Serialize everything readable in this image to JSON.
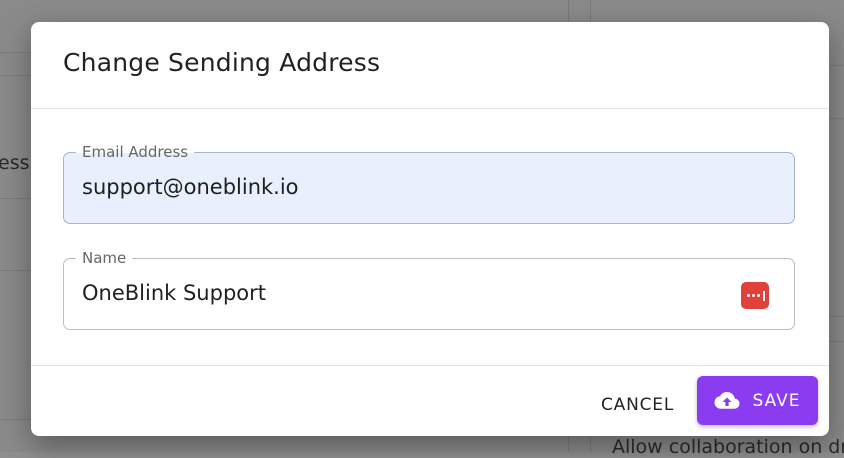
{
  "background": {
    "partial_text_left": "ess n",
    "partial_text_right_bottom": "Allow collaboration on dr"
  },
  "dialog": {
    "title": "Change Sending Address",
    "fields": [
      {
        "label": "Email Address",
        "value": "support@oneblink.io",
        "filled": true
      },
      {
        "label": "Name",
        "value": "OneBlink Support",
        "icon": "password-manager-icon"
      }
    ],
    "actions": {
      "cancel_label": "CANCEL",
      "save_label": "SAVE",
      "save_icon": "cloud-upload-icon"
    }
  },
  "colors": {
    "accent": "#8c3cf0",
    "field_fill": "#e8effd",
    "password_icon": "#e0413a"
  }
}
